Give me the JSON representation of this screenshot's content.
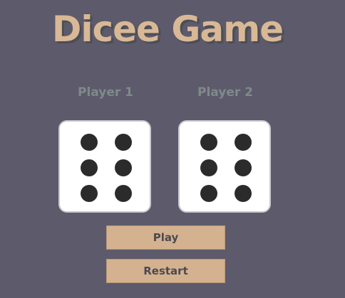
{
  "header": {
    "title": "Dicee Game"
  },
  "players": [
    {
      "label": "Player 1",
      "die_value": 6
    },
    {
      "label": "Player 2",
      "die_value": 6
    }
  ],
  "controls": {
    "play_label": "Play",
    "restart_label": "Restart"
  },
  "colors": {
    "background": "#5d5a6b",
    "title": "#d9b896",
    "button": "#d4b28f",
    "pip": "#2b2b2b"
  }
}
